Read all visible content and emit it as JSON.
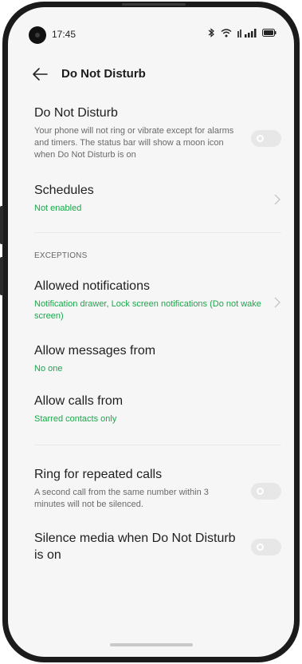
{
  "status_bar": {
    "time": "17:45"
  },
  "header": {
    "title": "Do Not Disturb"
  },
  "settings": {
    "dnd": {
      "title": "Do Not Disturb",
      "description": "Your phone will not ring or vibrate except for alarms and timers. The status bar will show a moon icon when Do Not Disturb is on",
      "enabled": false
    },
    "schedules": {
      "title": "Schedules",
      "subtitle": "Not enabled"
    },
    "exceptions_header": "EXCEPTIONS",
    "allowed_notifications": {
      "title": "Allowed notifications",
      "subtitle": "Notification drawer, Lock screen notifications (Do not wake screen)"
    },
    "allow_messages": {
      "title": "Allow messages from",
      "subtitle": "No one"
    },
    "allow_calls": {
      "title": "Allow calls from",
      "subtitle": "Starred contacts only"
    },
    "repeated_calls": {
      "title": "Ring for repeated calls",
      "description": "A second call from the same number within 3 minutes will not be silenced.",
      "enabled": false
    },
    "silence_media": {
      "title": "Silence media when Do Not Disturb is on",
      "enabled": false
    }
  },
  "colors": {
    "accent_green": "#19a84a",
    "toggle_off": "#e7e7e7",
    "background": "#f6f6f6"
  },
  "icons": [
    "bluetooth-icon",
    "wifi-icon",
    "signal-icon",
    "battery-icon",
    "back-arrow-icon",
    "chevron-right-icon"
  ]
}
